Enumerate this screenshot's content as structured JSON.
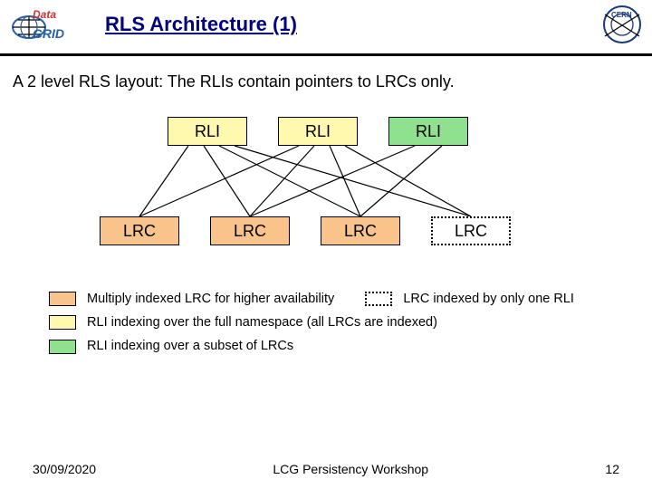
{
  "header": {
    "title": "RLS Architecture (1)",
    "logo_left_text_top": "Data",
    "logo_left_text_bottom": "GRID",
    "logo_right_text": "CERN"
  },
  "intro": "A 2 level RLS layout: The RLIs contain pointers to LRCs only.",
  "nodes": {
    "rli": [
      "RLI",
      "RLI",
      "RLI"
    ],
    "lrc": [
      "LRC",
      "LRC",
      "LRC",
      "LRC"
    ]
  },
  "legend": {
    "multiply_indexed": "Multiply indexed LRC for higher availability",
    "indexed_by_one": "LRC indexed by only one RLI",
    "full_namespace": "RLI indexing over the full namespace (all LRCs are indexed)",
    "subset": "RLI indexing over a subset of LRCs"
  },
  "footer": {
    "date": "30/09/2020",
    "center": "LCG Persistency Workshop",
    "page": "12"
  },
  "colors": {
    "title": "#000080",
    "rli_yellow": "#fff9b0",
    "rli_green": "#8fe08f",
    "lrc_orange": "#f9c38c"
  }
}
